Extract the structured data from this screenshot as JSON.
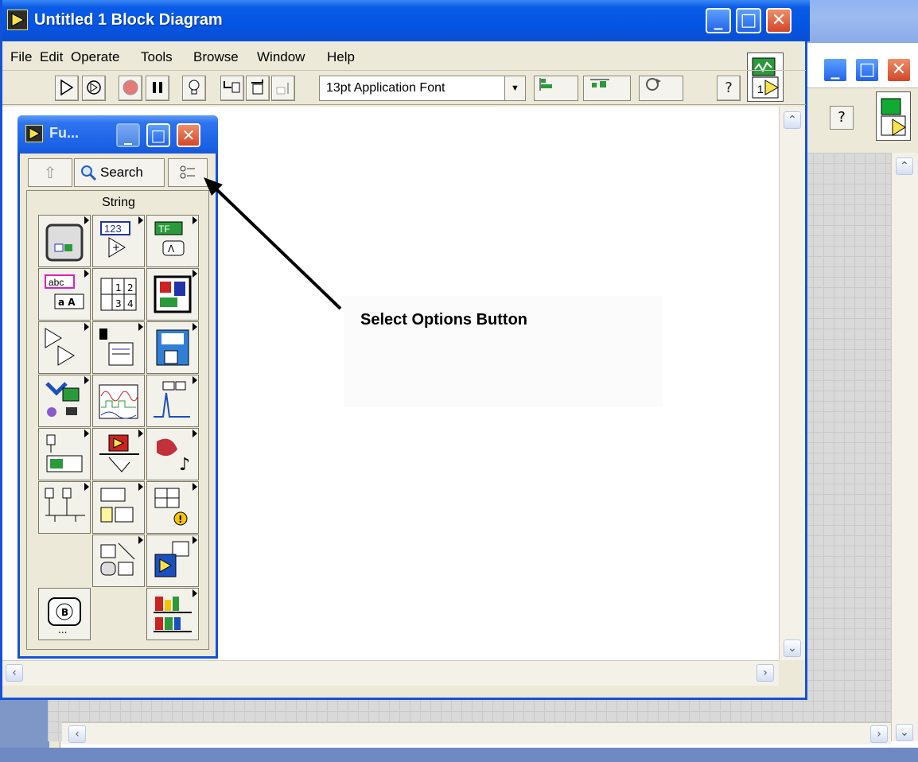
{
  "main_window": {
    "title": "Untitled 1 Block Diagram",
    "minimize_glyph": "_",
    "maximize_glyph": "□",
    "close_glyph": "✕"
  },
  "menu": {
    "items": [
      {
        "label": "File",
        "key": "F"
      },
      {
        "label": "Edit",
        "key": "E"
      },
      {
        "label": "Operate",
        "key": "O"
      },
      {
        "label": "Tools",
        "key": "T"
      },
      {
        "label": "Browse",
        "key": "B"
      },
      {
        "label": "Window",
        "key": "W"
      },
      {
        "label": "Help",
        "key": "H"
      }
    ]
  },
  "toolbar": {
    "font_selector_value": "13pt Application Font",
    "help_glyph": "?"
  },
  "palette": {
    "title": "Fu...",
    "search_label": "Search",
    "category": "String",
    "up_glyph": "⇧"
  },
  "annotation": {
    "label": "Select Options Button"
  },
  "icons": {
    "palette_cells": [
      "structures-icon",
      "numeric-icon",
      "boolean-icon",
      "string-icon",
      "array-icon",
      "cluster-icon",
      "comparison-icon",
      "timing-icon",
      "file-io-icon",
      "daq-icon",
      "waveform-icon",
      "analyze-icon",
      "instrument-io-icon",
      "application-control-icon",
      "graphics-sound-icon",
      "communication-icon",
      "report-generation-icon",
      "advanced-icon",
      "decorations-icon",
      "select-vi-icon",
      "express-icon",
      "user-libraries-icon"
    ]
  },
  "colors": {
    "titlebar_blue": "#0355e4",
    "close_red": "#d3462a",
    "window_face": "#ece9d8"
  }
}
